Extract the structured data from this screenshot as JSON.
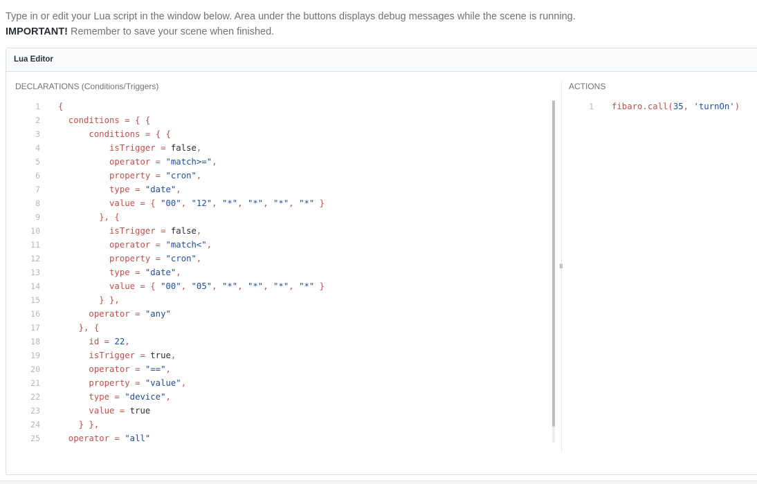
{
  "intro": {
    "line1": "Type in or edit your Lua script in the window below. Area under the buttons displays debug messages while the scene is running.",
    "important_label": "IMPORTANT!",
    "line2_rest": " Remember to save your scene when finished."
  },
  "panel": {
    "title": "Lua Editor"
  },
  "declarations": {
    "label": "DECLARATIONS (Conditions/Triggers)",
    "lines": [
      [
        {
          "t": "{",
          "c": "t-punct"
        }
      ],
      [
        {
          "t": "  conditions",
          "c": "t-key"
        },
        {
          "t": " = ",
          "c": "t-op"
        },
        {
          "t": "{ {",
          "c": "t-punct"
        }
      ],
      [
        {
          "t": "      conditions",
          "c": "t-key"
        },
        {
          "t": " = ",
          "c": "t-op"
        },
        {
          "t": "{ {",
          "c": "t-punct"
        }
      ],
      [
        {
          "t": "          isTrigger",
          "c": "t-key"
        },
        {
          "t": " = ",
          "c": "t-op"
        },
        {
          "t": "false",
          "c": "t-plain"
        },
        {
          "t": ",",
          "c": "t-punct"
        }
      ],
      [
        {
          "t": "          operator",
          "c": "t-key"
        },
        {
          "t": " = ",
          "c": "t-op"
        },
        {
          "t": "\"match>=\"",
          "c": "t-str"
        },
        {
          "t": ",",
          "c": "t-punct"
        }
      ],
      [
        {
          "t": "          property",
          "c": "t-key"
        },
        {
          "t": " = ",
          "c": "t-op"
        },
        {
          "t": "\"cron\"",
          "c": "t-str"
        },
        {
          "t": ",",
          "c": "t-punct"
        }
      ],
      [
        {
          "t": "          type",
          "c": "t-key"
        },
        {
          "t": " = ",
          "c": "t-op"
        },
        {
          "t": "\"date\"",
          "c": "t-str"
        },
        {
          "t": ",",
          "c": "t-punct"
        }
      ],
      [
        {
          "t": "          value",
          "c": "t-key"
        },
        {
          "t": " = ",
          "c": "t-op"
        },
        {
          "t": "{ ",
          "c": "t-punct"
        },
        {
          "t": "\"00\"",
          "c": "t-str"
        },
        {
          "t": ", ",
          "c": "t-punct"
        },
        {
          "t": "\"12\"",
          "c": "t-str"
        },
        {
          "t": ", ",
          "c": "t-punct"
        },
        {
          "t": "\"*\"",
          "c": "t-str"
        },
        {
          "t": ", ",
          "c": "t-punct"
        },
        {
          "t": "\"*\"",
          "c": "t-str"
        },
        {
          "t": ", ",
          "c": "t-punct"
        },
        {
          "t": "\"*\"",
          "c": "t-str"
        },
        {
          "t": ", ",
          "c": "t-punct"
        },
        {
          "t": "\"*\"",
          "c": "t-str"
        },
        {
          "t": " }",
          "c": "t-punct"
        }
      ],
      [
        {
          "t": "        }, {",
          "c": "t-punct"
        }
      ],
      [
        {
          "t": "          isTrigger",
          "c": "t-key"
        },
        {
          "t": " = ",
          "c": "t-op"
        },
        {
          "t": "false",
          "c": "t-plain"
        },
        {
          "t": ",",
          "c": "t-punct"
        }
      ],
      [
        {
          "t": "          operator",
          "c": "t-key"
        },
        {
          "t": " = ",
          "c": "t-op"
        },
        {
          "t": "\"match<\"",
          "c": "t-str"
        },
        {
          "t": ",",
          "c": "t-punct"
        }
      ],
      [
        {
          "t": "          property",
          "c": "t-key"
        },
        {
          "t": " = ",
          "c": "t-op"
        },
        {
          "t": "\"cron\"",
          "c": "t-str"
        },
        {
          "t": ",",
          "c": "t-punct"
        }
      ],
      [
        {
          "t": "          type",
          "c": "t-key"
        },
        {
          "t": " = ",
          "c": "t-op"
        },
        {
          "t": "\"date\"",
          "c": "t-str"
        },
        {
          "t": ",",
          "c": "t-punct"
        }
      ],
      [
        {
          "t": "          value",
          "c": "t-key"
        },
        {
          "t": " = ",
          "c": "t-op"
        },
        {
          "t": "{ ",
          "c": "t-punct"
        },
        {
          "t": "\"00\"",
          "c": "t-str"
        },
        {
          "t": ", ",
          "c": "t-punct"
        },
        {
          "t": "\"05\"",
          "c": "t-str"
        },
        {
          "t": ", ",
          "c": "t-punct"
        },
        {
          "t": "\"*\"",
          "c": "t-str"
        },
        {
          "t": ", ",
          "c": "t-punct"
        },
        {
          "t": "\"*\"",
          "c": "t-str"
        },
        {
          "t": ", ",
          "c": "t-punct"
        },
        {
          "t": "\"*\"",
          "c": "t-str"
        },
        {
          "t": ", ",
          "c": "t-punct"
        },
        {
          "t": "\"*\"",
          "c": "t-str"
        },
        {
          "t": " }",
          "c": "t-punct"
        }
      ],
      [
        {
          "t": "        } },",
          "c": "t-punct"
        }
      ],
      [
        {
          "t": "      operator",
          "c": "t-key"
        },
        {
          "t": " = ",
          "c": "t-op"
        },
        {
          "t": "\"any\"",
          "c": "t-str"
        }
      ],
      [
        {
          "t": "    }, {",
          "c": "t-punct"
        }
      ],
      [
        {
          "t": "      id",
          "c": "t-key"
        },
        {
          "t": " = ",
          "c": "t-op"
        },
        {
          "t": "22",
          "c": "t-num"
        },
        {
          "t": ",",
          "c": "t-punct"
        }
      ],
      [
        {
          "t": "      isTrigger",
          "c": "t-key"
        },
        {
          "t": " = ",
          "c": "t-op"
        },
        {
          "t": "true",
          "c": "t-plain"
        },
        {
          "t": ",",
          "c": "t-punct"
        }
      ],
      [
        {
          "t": "      operator",
          "c": "t-key"
        },
        {
          "t": " = ",
          "c": "t-op"
        },
        {
          "t": "\"==\"",
          "c": "t-str"
        },
        {
          "t": ",",
          "c": "t-punct"
        }
      ],
      [
        {
          "t": "      property",
          "c": "t-key"
        },
        {
          "t": " = ",
          "c": "t-op"
        },
        {
          "t": "\"value\"",
          "c": "t-str"
        },
        {
          "t": ",",
          "c": "t-punct"
        }
      ],
      [
        {
          "t": "      type",
          "c": "t-key"
        },
        {
          "t": " = ",
          "c": "t-op"
        },
        {
          "t": "\"device\"",
          "c": "t-str"
        },
        {
          "t": ",",
          "c": "t-punct"
        }
      ],
      [
        {
          "t": "      value",
          "c": "t-key"
        },
        {
          "t": " = ",
          "c": "t-op"
        },
        {
          "t": "true",
          "c": "t-plain"
        }
      ],
      [
        {
          "t": "    } },",
          "c": "t-punct"
        }
      ],
      [
        {
          "t": "  operator",
          "c": "t-key"
        },
        {
          "t": " = ",
          "c": "t-op"
        },
        {
          "t": "\"all\"",
          "c": "t-str"
        }
      ]
    ]
  },
  "actions": {
    "label": "ACTIONS",
    "lines": [
      [
        {
          "t": "fibaro.call(",
          "c": "t-key"
        },
        {
          "t": "35",
          "c": "t-num"
        },
        {
          "t": ", ",
          "c": "t-punct"
        },
        {
          "t": "'turnOn'",
          "c": "t-str"
        },
        {
          "t": ")",
          "c": "t-punct"
        }
      ]
    ]
  },
  "resize_handle_glyph": "III"
}
